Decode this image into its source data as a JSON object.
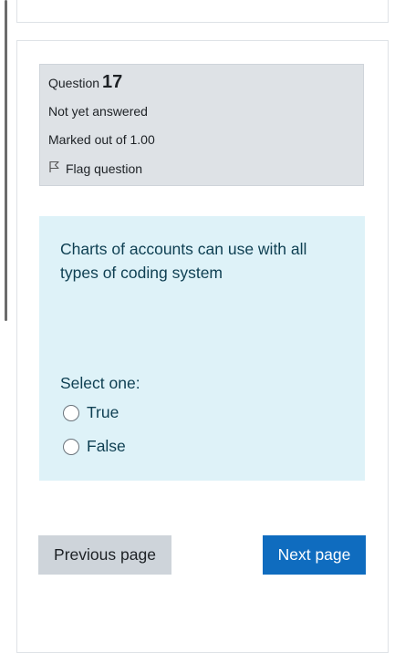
{
  "question": {
    "label": "Question",
    "number": "17",
    "status": "Not yet answered",
    "marks": "Marked out of 1.00",
    "flag_label": "Flag question",
    "text": "Charts of accounts can use with all types of coding system"
  },
  "answer": {
    "prompt": "Select one:",
    "options": [
      {
        "label": "True"
      },
      {
        "label": "False"
      }
    ]
  },
  "navigation": {
    "previous_label": "Previous page",
    "next_label": "Next page"
  },
  "colors": {
    "info_bg": "#dee2e6",
    "content_bg": "#def2f8",
    "content_text": "#0e3f52",
    "primary_button": "#0f6cbf",
    "secondary_button": "#ced4da"
  }
}
